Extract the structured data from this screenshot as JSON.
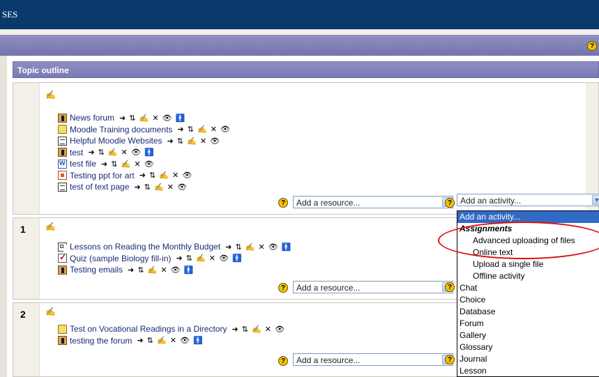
{
  "header": {
    "site_title_fragment": "SES"
  },
  "topic_outline": {
    "title": "Topic outline"
  },
  "help_glyph": "?",
  "edit_glyph": "✍",
  "actions_glyphs": {
    "move": "➜",
    "move_updown": "⇅",
    "edit": "✍",
    "delete": "✕",
    "hide": "👁",
    "roles": "🚹"
  },
  "sections": [
    {
      "number": "",
      "items": [
        {
          "icon": "forum-icon",
          "label": "News forum",
          "roles": true
        },
        {
          "icon": "folder-icon",
          "label": "Moodle Training documents",
          "roles": false
        },
        {
          "icon": "page-icon",
          "label": "Helpful Moodle Websites",
          "roles": false
        },
        {
          "icon": "forum-icon",
          "label": "test",
          "roles": true
        },
        {
          "icon": "word-icon",
          "label": "test file",
          "roles": false
        },
        {
          "icon": "ppt-icon",
          "label": "Testing ppt for art",
          "roles": false
        },
        {
          "icon": "page-icon",
          "label": "test of text page",
          "roles": false
        }
      ],
      "add_resource": "Add a resource...",
      "add_activity": "Add an activity..."
    },
    {
      "number": "1",
      "items": [
        {
          "icon": "lesson-icon",
          "label": "Lessons on Reading the Monthly Budget",
          "roles": true
        },
        {
          "icon": "quiz-icon",
          "label": "Quiz (sample Biology fill-in)",
          "roles": true
        },
        {
          "icon": "forum-icon",
          "label": "Testing emails",
          "roles": true
        }
      ],
      "add_resource": "Add a resource..."
    },
    {
      "number": "2",
      "items": [
        {
          "icon": "folder-icon",
          "label": "Test on Vocational Readings in a Directory",
          "roles": false
        },
        {
          "icon": "forum-icon",
          "label": "testing the forum",
          "roles": true
        }
      ],
      "add_resource": "Add a resource..."
    }
  ],
  "activity_dropdown": {
    "selected": "Add an activity...",
    "options": [
      {
        "label": "Add an activity...",
        "kind": "selected"
      },
      {
        "label": "Assignments",
        "kind": "group"
      },
      {
        "label": "Advanced uploading of files",
        "kind": "sub"
      },
      {
        "label": "Online text",
        "kind": "sub"
      },
      {
        "label": "Upload a single file",
        "kind": "sub"
      },
      {
        "label": "Offline activity",
        "kind": "sub"
      },
      {
        "label": "Chat",
        "kind": "item"
      },
      {
        "label": "Choice",
        "kind": "item"
      },
      {
        "label": "Database",
        "kind": "item"
      },
      {
        "label": "Forum",
        "kind": "item"
      },
      {
        "label": "Gallery",
        "kind": "item"
      },
      {
        "label": "Glossary",
        "kind": "item"
      },
      {
        "label": "Journal",
        "kind": "item"
      },
      {
        "label": "Lesson",
        "kind": "item"
      }
    ]
  },
  "colors": {
    "header_bg": "#0a3a6b",
    "nav_bg": "#7f7fb6",
    "highlight": "#316ac5",
    "annotation": "#e01010"
  }
}
